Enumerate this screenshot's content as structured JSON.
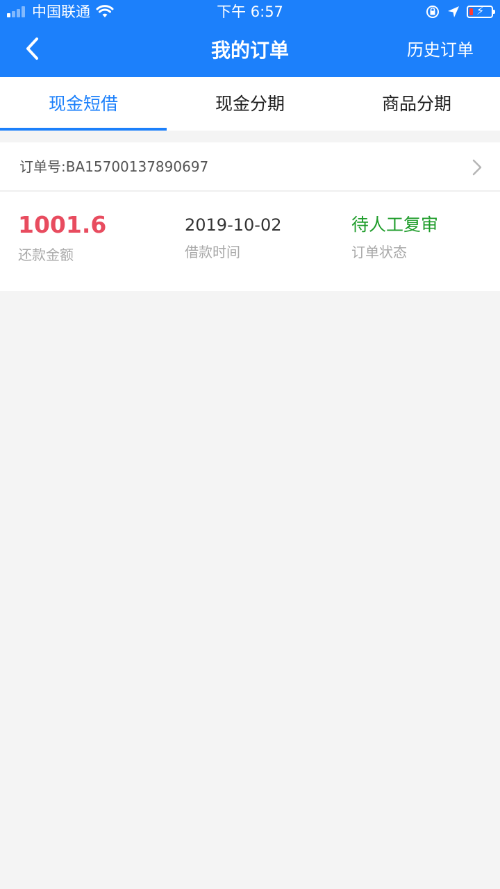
{
  "status_bar": {
    "carrier": "中国联通",
    "time": "下午 6:57"
  },
  "nav": {
    "title": "我的订单",
    "right_action": "历史订单"
  },
  "tabs": [
    {
      "label": "现金短借",
      "active": true
    },
    {
      "label": "现金分期",
      "active": false
    },
    {
      "label": "商品分期",
      "active": false
    }
  ],
  "order": {
    "order_number_label": "订单号:BA15700137890697",
    "amount": "1001.6",
    "amount_label": "还款金额",
    "date": "2019-10-02",
    "date_label": "借款时间",
    "status": "待人工复审",
    "status_label": "订单状态"
  },
  "colors": {
    "primary": "#1c80fb",
    "amount": "#e84c5f",
    "status": "#1e9c2a",
    "background": "#f4f4f4"
  }
}
